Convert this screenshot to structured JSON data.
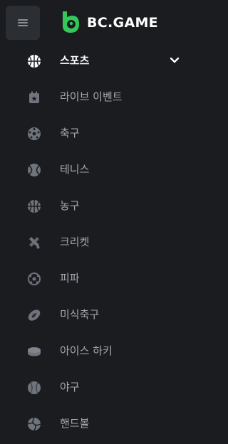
{
  "header": {
    "brand": "BC.GAME",
    "brand_color": "#34c759"
  },
  "nav": {
    "items": [
      {
        "label": "스포츠",
        "icon": "basketball-icon",
        "active": true
      },
      {
        "label": "라이브 이벤트",
        "icon": "live-calendar-icon"
      },
      {
        "label": "축구",
        "icon": "soccer-ball-icon"
      },
      {
        "label": "테니스",
        "icon": "tennis-ball-icon"
      },
      {
        "label": "농구",
        "icon": "basketball-icon"
      },
      {
        "label": "크리켓",
        "icon": "cricket-bat-icon"
      },
      {
        "label": "피파",
        "icon": "fifa-ball-icon"
      },
      {
        "label": "미식축구",
        "icon": "american-football-icon"
      },
      {
        "label": "아이스 하키",
        "icon": "hockey-puck-icon"
      },
      {
        "label": "야구",
        "icon": "baseball-icon"
      },
      {
        "label": "핸드볼",
        "icon": "handball-icon"
      }
    ]
  },
  "colors": {
    "background": "#1a1c20",
    "icon_muted": "#6f737b",
    "label_muted": "#a6aab1",
    "active": "#ffffff"
  }
}
